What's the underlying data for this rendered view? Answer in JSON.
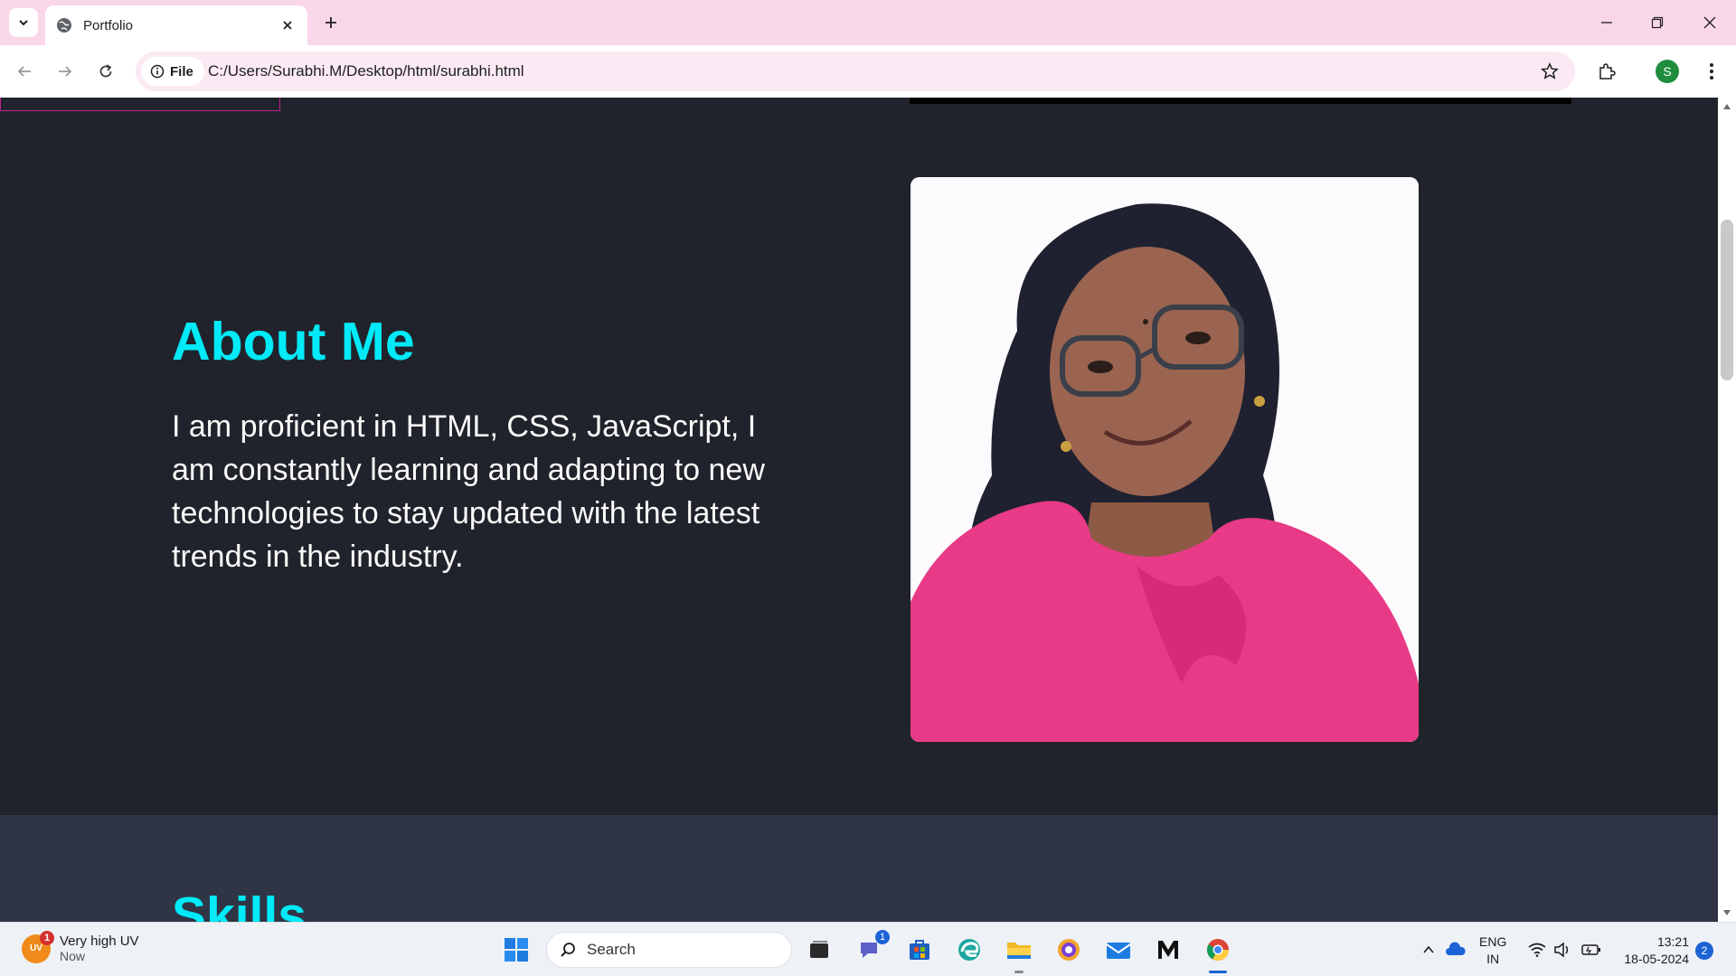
{
  "browser": {
    "tab": {
      "title": "Portfolio",
      "favicon": "globe-icon"
    },
    "address": {
      "chip_label": "File",
      "url": "C:/Users/Surabhi.M/Desktop/html/surabhi.html"
    },
    "profile_initial": "S"
  },
  "page": {
    "about": {
      "title": "About Me",
      "text": "I am proficient in HTML, CSS, JavaScript, I am constantly learning and adapting to new technologies to stay updated with the latest trends in the industry."
    },
    "skills": {
      "title": "Skills"
    },
    "colors": {
      "accent": "#00eaf7",
      "background": "#20232b",
      "band": "#2f3544",
      "nav_border": "#c21f96"
    }
  },
  "taskbar": {
    "weather": {
      "badge": "UV",
      "count": "1",
      "title": "Very high UV",
      "subtitle": "Now"
    },
    "search_label": "Search",
    "teams_badge": "1",
    "language": {
      "line1": "ENG",
      "line2": "IN"
    },
    "clock": {
      "time": "13:21",
      "date": "18-05-2024"
    },
    "notification_count": "2"
  }
}
